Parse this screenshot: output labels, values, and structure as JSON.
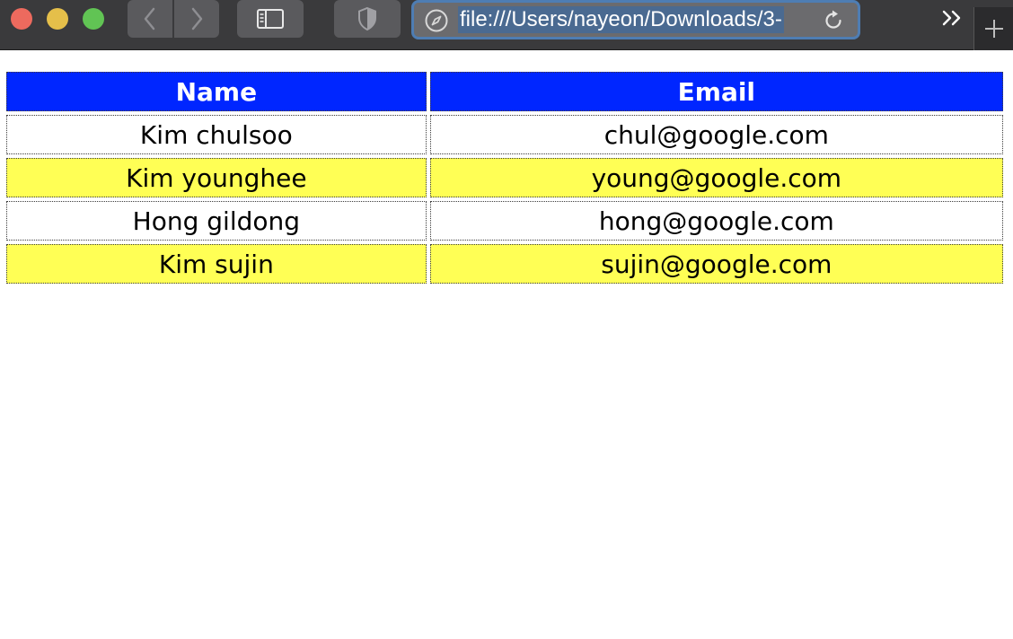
{
  "browser": {
    "url": "file:///Users/nayeon/Downloads/3-",
    "icons": {
      "back": "chevron-left-icon",
      "forward": "chevron-right-icon",
      "sidebar": "sidebar-icon",
      "privacy": "shield-icon",
      "site": "compass-icon",
      "reload": "reload-icon",
      "overflow": "double-chevron-right-icon",
      "new_tab": "plus-icon"
    }
  },
  "table": {
    "headers": [
      "Name",
      "Email"
    ],
    "rows": [
      [
        "Kim chulsoo",
        "chul@google.com"
      ],
      [
        "Kim younghee",
        "young@google.com"
      ],
      [
        "Hong gildong",
        "hong@google.com"
      ],
      [
        "Kim sujin",
        "sujin@google.com"
      ]
    ]
  },
  "colors": {
    "header_bg": "#0026ff",
    "header_text": "#ffffff",
    "alt_row_bg": "#ffff55",
    "row_bg": "#ffffff"
  }
}
